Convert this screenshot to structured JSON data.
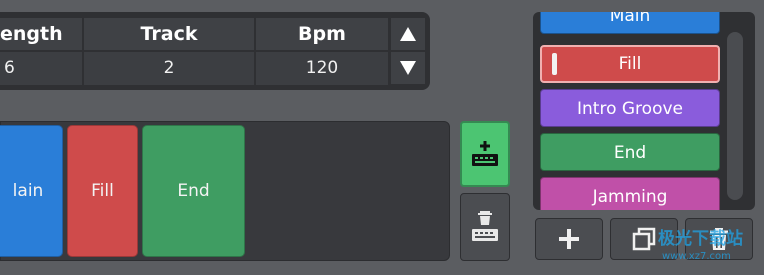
{
  "table": {
    "headers": [
      "ength",
      "Track",
      "Bpm"
    ],
    "values": [
      "6",
      "2",
      "120"
    ],
    "up_icon": "arrow-up-icon",
    "down_icon": "arrow-down-icon"
  },
  "patterns": [
    {
      "label": "lain",
      "color": "#2a7ed8"
    },
    {
      "label": "Fill",
      "color": "#cf4b4b"
    },
    {
      "label": "End",
      "color": "#3f9d62"
    }
  ],
  "tools": {
    "add_icon": "add-pattern-icon",
    "delete_icon": "delete-pattern-icon"
  },
  "list": {
    "items": [
      {
        "label": "Main",
        "color": "#2a7ed8"
      },
      {
        "label": "Fill",
        "color": "#cf4b4b",
        "selected": true
      },
      {
        "label": "Intro Groove",
        "color": "#8a5cdc"
      },
      {
        "label": "End",
        "color": "#3f9d62"
      },
      {
        "label": "Jamming",
        "color": "#c050a8"
      }
    ]
  },
  "list_buttons": {
    "add_icon": "plus-icon",
    "duplicate_icon": "duplicate-icon",
    "delete_icon": "trash-icon"
  },
  "watermark": {
    "title": "极光下载站",
    "url": "www.xz7.com"
  }
}
